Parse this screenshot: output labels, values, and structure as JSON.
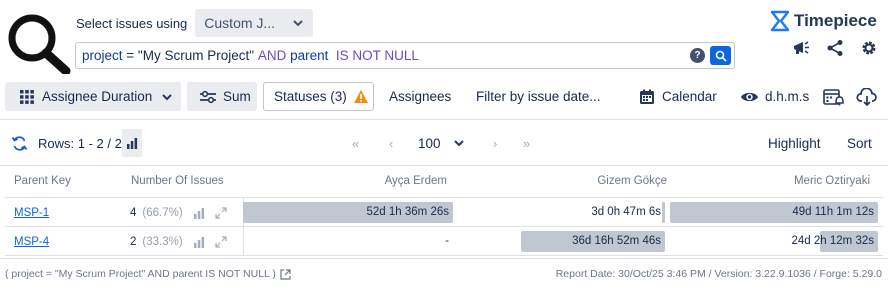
{
  "selector": {
    "label": "Select issues using",
    "value": "Custom J..."
  },
  "jql": {
    "field": "project",
    "op1": "= \"My Scrum Project\"",
    "and": "AND",
    "field2": "parent",
    "tail": "IS NOT NULL"
  },
  "brand": {
    "name": "Timepiece"
  },
  "toolbar": {
    "report_type": "Assignee Duration",
    "sum": "Sum",
    "statuses": "Statuses (3)",
    "assignees": "Assignees",
    "filter_date": "Filter by issue date...",
    "calendar": "Calendar",
    "format": "d.h.m.s"
  },
  "rows_bar": {
    "rows": "Rows: 1 - 2 / 2",
    "page_size": "100",
    "highlight": "Highlight",
    "sort": "Sort"
  },
  "table": {
    "headers": [
      "Parent Key",
      "Number Of Issues",
      "Ayça Erdem",
      "Gizem Gökçe",
      "Meric Oztiryaki"
    ],
    "rows": [
      {
        "key": "MSP-1",
        "count": "4",
        "pct": "(66.7%)",
        "c1": "52d 1h 36m 26s",
        "c1_fill": 1.0,
        "c2": "3d 0h 47m 6s",
        "c2_fill": 0.017,
        "c3": "49d 11h 1m 12s",
        "c3_fill": 1.0
      },
      {
        "key": "MSP-4",
        "count": "2",
        "pct": "(33.3%)",
        "c1": "-",
        "c1_fill": 0,
        "c2": "36d 16h 52m 46s",
        "c2_fill": 0.7,
        "c3": "24d 2h 12m 32s",
        "c3_fill": 0.28
      }
    ]
  },
  "footer": {
    "query": "( project = \"My Scrum Project\" AND parent IS NOT NULL )",
    "meta": "Report Date: 30/Oct/25 3:46 PM / Version: 3.22.9.1036 / Forge: 5.29.0"
  }
}
